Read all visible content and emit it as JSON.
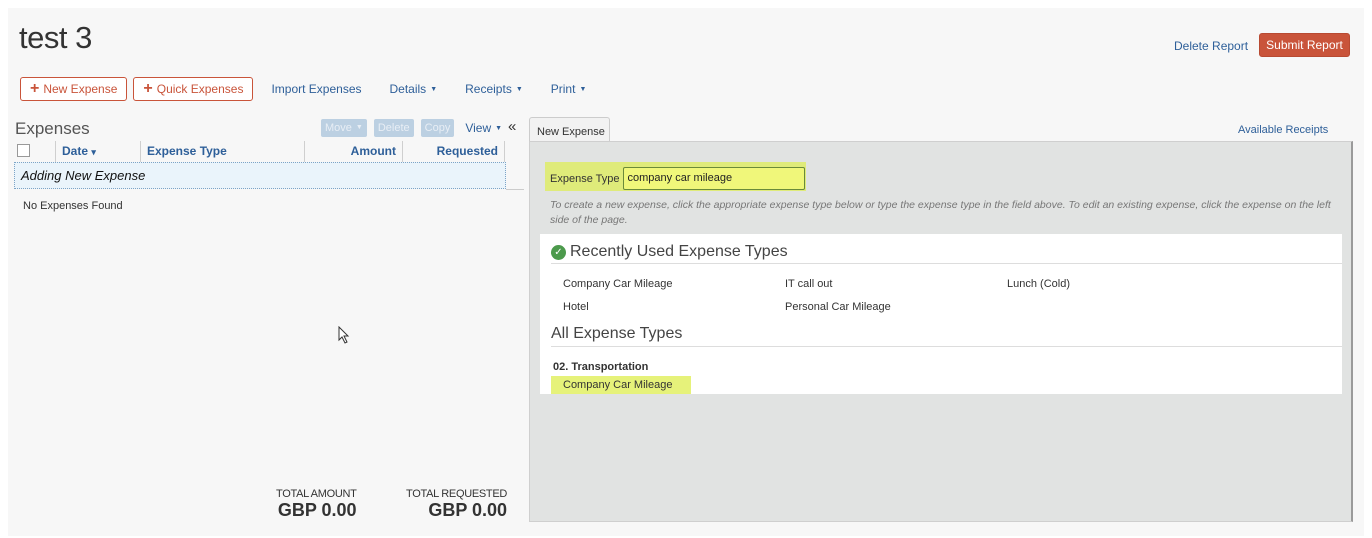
{
  "header": {
    "title": "test 3",
    "delete_report": "Delete Report",
    "submit_report": "Submit Report"
  },
  "toolbar": {
    "new_expense": "New Expense",
    "quick_expenses": "Quick Expenses",
    "import_expenses": "Import Expenses",
    "details": "Details",
    "receipts": "Receipts",
    "print": "Print",
    "plus_icon": "+",
    "caret": "▼"
  },
  "expenses": {
    "title": "Expenses",
    "move": "Move",
    "delete": "Delete",
    "copy": "Copy",
    "view": "View",
    "collapse_icon": "«",
    "columns": [
      "Date",
      "Expense Type",
      "Amount",
      "Requested"
    ],
    "date_caret": "▾",
    "adding_row": "Adding New Expense",
    "empty": "No Expenses Found",
    "total_amount_label": "TOTAL AMOUNT",
    "total_amount": "GBP 0.00",
    "total_requested_label": "TOTAL REQUESTED",
    "total_requested": "GBP 0.00"
  },
  "new_expense": {
    "tab": "New Expense",
    "available_receipts": "Available Receipts",
    "expense_type_label": "Expense Type",
    "expense_type_value": "company car mileage",
    "hint": "To create a new expense, click the appropriate expense type below or type the expense type in the field above. To edit an existing expense, click the expense on the left side of the page.",
    "recent_title": "Recently Used Expense Types",
    "recent": [
      "Company Car Mileage",
      "IT call out",
      "Lunch (Cold)",
      "Hotel",
      "Personal Car Mileage"
    ],
    "all_title": "All Expense Types",
    "category": "02. Transportation",
    "category_item": "Company Car Mileage",
    "check_icon": "✓"
  },
  "colors": {
    "accent": "#c9543a",
    "link": "#2e5f99",
    "highlight": "#e6f27a"
  }
}
